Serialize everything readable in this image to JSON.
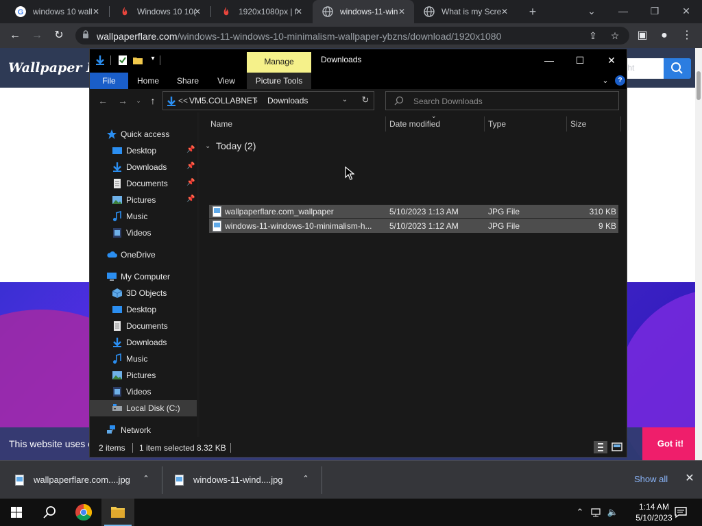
{
  "browser": {
    "tabs": [
      {
        "title": "windows 10 wall",
        "favicon": "google-icon"
      },
      {
        "title": "Windows 10 10(",
        "favicon": "wallpaper-flare-icon"
      },
      {
        "title": "1920x1080px | f",
        "favicon": "wallpaper-flare-icon"
      },
      {
        "title": "windows-11-win",
        "favicon": "globe-icon"
      },
      {
        "title": "What is my Scre",
        "favicon": "globe-icon"
      }
    ],
    "active_tab": 3,
    "url_host": "wallpaperflare.com",
    "url_path": "/windows-11-windows-10-minimalism-wallpaper-ybzns/download/1920x1080"
  },
  "site": {
    "logo": "Wallpaper Flar",
    "search_placeholder": "ight",
    "cookie_text": "This website uses co",
    "cookie_button": "Got it!"
  },
  "explorer": {
    "title": "Downloads",
    "manage_tab": "Manage",
    "ribbon_tabs": [
      "File",
      "Home",
      "Share",
      "View",
      "Picture Tools"
    ],
    "breadcrumb": {
      "prefix": "<<",
      "root": "VM5.COLLABNET",
      "current": "Downloads"
    },
    "search_placeholder": "Search Downloads",
    "nav": {
      "quick_access": "Quick access",
      "quick_items": [
        {
          "label": "Desktop",
          "pinned": true
        },
        {
          "label": "Downloads",
          "pinned": true
        },
        {
          "label": "Documents",
          "pinned": true
        },
        {
          "label": "Pictures",
          "pinned": true
        },
        {
          "label": "Music",
          "pinned": false
        },
        {
          "label": "Videos",
          "pinned": false
        }
      ],
      "onedrive": "OneDrive",
      "computer": "My Computer",
      "computer_items": [
        "3D Objects",
        "Desktop",
        "Documents",
        "Downloads",
        "Music",
        "Pictures",
        "Videos",
        "Local Disk (C:)"
      ],
      "network": "Network"
    },
    "columns": [
      "Name",
      "Date modified",
      "Type",
      "Size"
    ],
    "group": "Today (2)",
    "files": [
      {
        "name": "wallpaperflare.com_wallpaper",
        "date": "5/10/2023 1:13 AM",
        "type": "JPG File",
        "size": "310 KB"
      },
      {
        "name": "windows-11-windows-10-minimalism-h...",
        "date": "5/10/2023 1:12 AM",
        "type": "JPG File",
        "size": "9 KB"
      }
    ],
    "status": {
      "items": "2 items",
      "selected": "1 item selected",
      "size": "8.32 KB"
    }
  },
  "downloads_bar": {
    "items": [
      "wallpaperflare.com....jpg",
      "windows-11-wind....jpg"
    ],
    "show_all": "Show all"
  },
  "taskbar": {
    "time": "1:14 AM",
    "date": "5/10/2023"
  },
  "colors": {
    "manage_tab": "#f5f18a",
    "file_tab": "#1a5ec9",
    "cookie_button": "#ef1e6b",
    "link": "#8ab4f8"
  }
}
